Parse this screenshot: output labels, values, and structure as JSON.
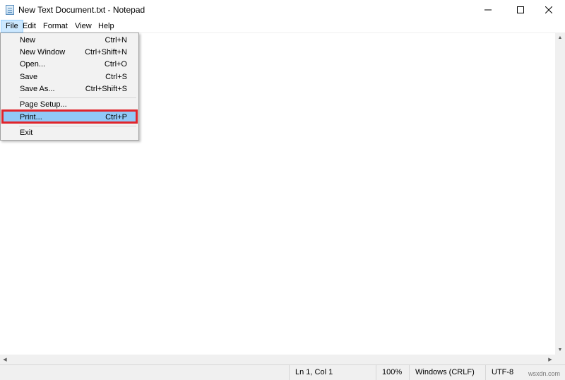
{
  "window": {
    "title": "New Text Document.txt - Notepad",
    "app_icon": "notepad-icon",
    "controls": {
      "minimize_icon": "minimize-icon",
      "maximize_icon": "maximize-icon",
      "close_icon": "close-icon"
    }
  },
  "menubar": {
    "items": [
      {
        "label": "File",
        "active": true
      },
      {
        "label": "Edit"
      },
      {
        "label": "Format"
      },
      {
        "label": "View"
      },
      {
        "label": "Help"
      }
    ]
  },
  "file_menu": {
    "items": [
      {
        "label": "New",
        "shortcut": "Ctrl+N"
      },
      {
        "label": "New Window",
        "shortcut": "Ctrl+Shift+N"
      },
      {
        "label": "Open...",
        "shortcut": "Ctrl+O"
      },
      {
        "label": "Save",
        "shortcut": "Ctrl+S"
      },
      {
        "label": "Save As...",
        "shortcut": "Ctrl+Shift+S"
      },
      {
        "label": "Page Setup...",
        "shortcut": ""
      },
      {
        "label": "Print...",
        "shortcut": "Ctrl+P",
        "highlighted": true
      },
      {
        "label": "Exit",
        "shortcut": ""
      }
    ]
  },
  "statusbar": {
    "position": "Ln 1, Col 1",
    "zoom": "100%",
    "line_ending": "Windows (CRLF)",
    "encoding": "UTF-8"
  },
  "watermark": "wsxdn.com",
  "colors": {
    "menu_highlight": "#91c9f7",
    "annotation_box": "#e0242b",
    "active_menu": "#cce8ff"
  }
}
